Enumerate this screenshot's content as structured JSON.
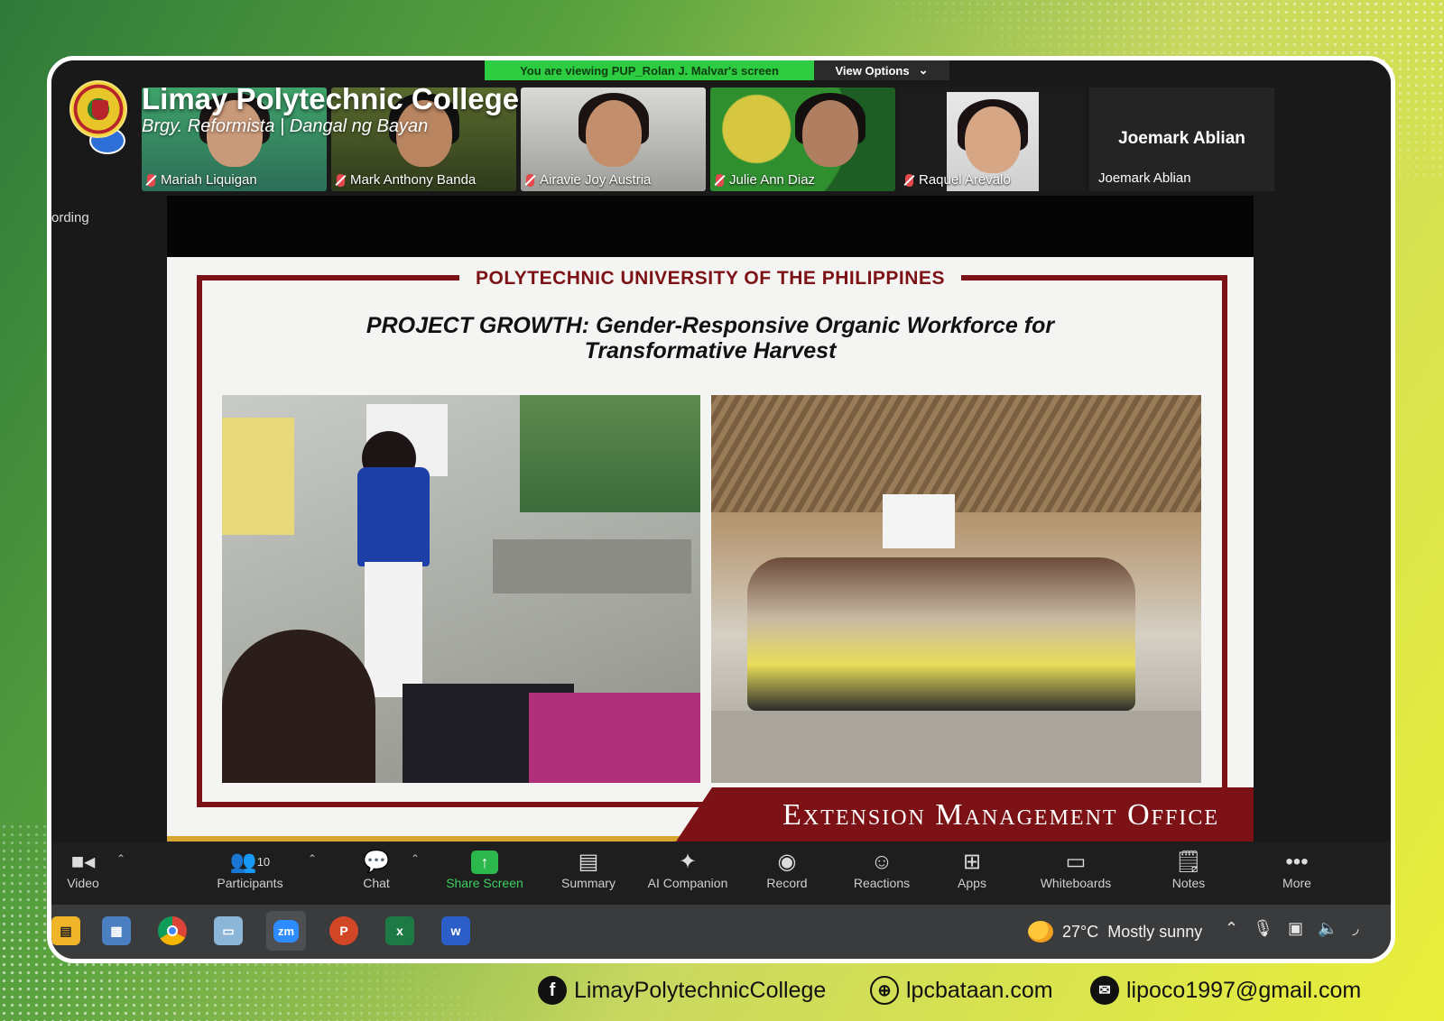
{
  "zoom": {
    "viewing_banner": "You are viewing PUP_Rolan J. Malvar's screen",
    "view_options": "View Options",
    "recording_label": "ording"
  },
  "brand": {
    "title": "Limay Polytechnic College",
    "subtitle": "Brgy. Reformista | Dangal ng Bayan"
  },
  "participants": [
    {
      "name": "Mariah Liquigan"
    },
    {
      "name": "Mark Anthony Banda"
    },
    {
      "name": "Airavie Joy Austria"
    },
    {
      "name": "Julie Ann Diaz"
    },
    {
      "name": "Raquel Arevalo"
    },
    {
      "name": "Joemark Ablian",
      "label": "Joemark Ablian"
    }
  ],
  "slide": {
    "university": "POLYTECHNIC UNIVERSITY OF THE PHILIPPINES",
    "title_line1": "PROJECT GROWTH: Gender-Responsive Organic Workforce for",
    "title_line2": "Transformative Harvest",
    "office": "Extension Management Office",
    "colors": {
      "maroon": "#7c1216",
      "gold": "#d8a731"
    }
  },
  "toolbar": {
    "video": "Video",
    "participants": "Participants",
    "participants_count": "10",
    "chat": "Chat",
    "share": "Share Screen",
    "summary": "Summary",
    "ai": "AI Companion",
    "record": "Record",
    "reactions": "Reactions",
    "apps": "Apps",
    "whiteboards": "Whiteboards",
    "notes": "Notes",
    "more": "More"
  },
  "taskbar": {
    "weather_temp": "27°C",
    "weather_desc": "Mostly sunny"
  },
  "footer": {
    "facebook": "LimayPolytechnicCollege",
    "website": "lpcbataan.com",
    "email": "lipoco1997@gmail.com"
  }
}
